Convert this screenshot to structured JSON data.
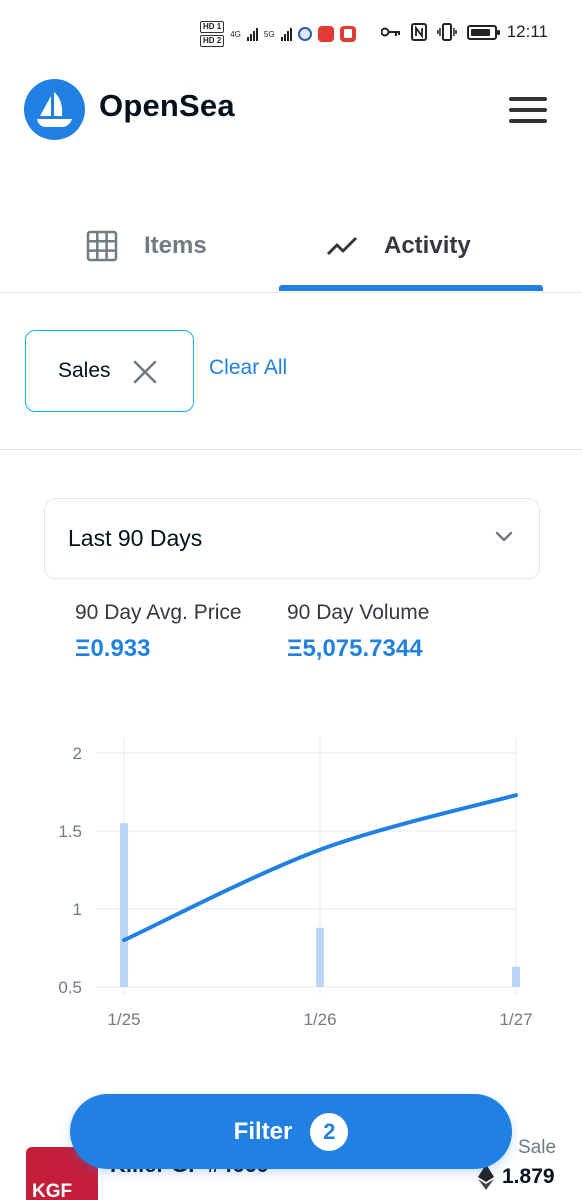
{
  "status_bar": {
    "time": "12:11",
    "sim1": "HD 1",
    "sim2": "HD 2",
    "net1": "4G",
    "net2": "5G"
  },
  "header": {
    "brand": "OpenSea",
    "logo_icon": "opensea-boat-icon",
    "menu_icon": "hamburger-menu-icon"
  },
  "tabs": [
    {
      "label": "Items",
      "icon": "grid-icon",
      "active": false
    },
    {
      "label": "Activity",
      "icon": "trending-line-icon",
      "active": true
    }
  ],
  "filters": {
    "chips": [
      {
        "label": "Sales"
      }
    ],
    "clear_all": "Clear All"
  },
  "period_select": {
    "value": "Last 90 Days"
  },
  "stats": [
    {
      "label": "90 Day Avg. Price",
      "value": "Ξ0.933"
    },
    {
      "label": "90 Day Volume",
      "value": "Ξ5,075.7344"
    }
  ],
  "chart_data": {
    "type": "line",
    "x": [
      "1/25",
      "1/26",
      "1/27"
    ],
    "series": [
      {
        "kind": "line",
        "values": [
          0.8,
          1.38,
          1.73
        ]
      },
      {
        "kind": "bar",
        "values": [
          1.55,
          0.88,
          0.63
        ]
      }
    ],
    "y_ticks": [
      "2",
      "1.5",
      "1",
      "0.5"
    ],
    "ylim": [
      0.5,
      2
    ],
    "grid": true,
    "line_color": "#2081e2",
    "bar_color": "#b9d7f5"
  },
  "activity_row": {
    "thumb_text": "KGF",
    "name": "Killer GF #4669",
    "event_type": "Sale",
    "price": "1.879"
  },
  "filter_button": {
    "label": "Filter",
    "count": "2"
  },
  "colors": {
    "accent": "#2081e2",
    "chip_border": "#15b2e5",
    "text_primary": "#04111d",
    "text_secondary": "#707a83"
  }
}
